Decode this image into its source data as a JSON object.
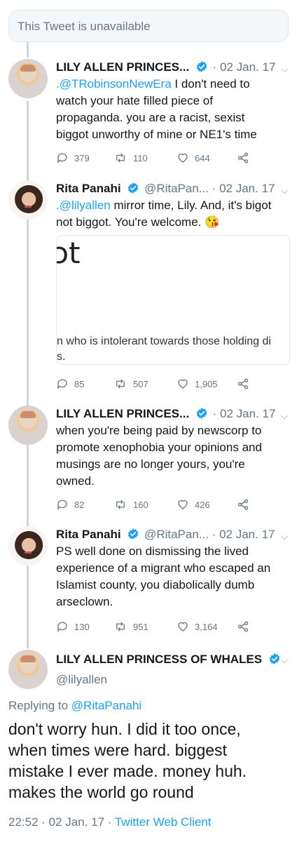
{
  "unavailable": {
    "label": "This Tweet is unavailable"
  },
  "tweets": [
    {
      "name": "LILY ALLEN PRINCES...",
      "handle": "",
      "date": "· 02 Jan. 17",
      "mention": ".@TRobinsonNewEra",
      "line1_rest": " I don't need to",
      "line2": "watch your hate filled piece of",
      "line3": "propaganda. you are a racist, sexist",
      "line4": "biggot unworthy of mine or NE1's time",
      "replies": "379",
      "retweets": "110",
      "likes": "644"
    },
    {
      "name": "Rita Panahi",
      "handle": "@RitaPan...",
      "date": "· 02 Jan. 17",
      "mention": ".@lilyallen",
      "line1_rest": " mirror time, Lily. And, it's bigot",
      "line2": "not biggot. You're welcome. 😘",
      "card_big": "ɔt",
      "card_line1": "n who is intolerant towards those holding di",
      "card_line2": "s.",
      "replies": "85",
      "retweets": "507",
      "likes": "1,905"
    },
    {
      "name": "LILY ALLEN PRINCES...",
      "handle": "",
      "date": "· 02 Jan. 17",
      "line1": "when you're being paid by newscorp to",
      "line2": "promote xenophobia your opinions and",
      "line3": "musings are no longer yours, you're",
      "line4": "owned.",
      "replies": "82",
      "retweets": "160",
      "likes": "426"
    },
    {
      "name": "Rita Panahi",
      "handle": "@RitaPan...",
      "date": "· 02 Jan. 17",
      "line1": "PS well done on dismissing the lived",
      "line2": "experience of a migrant who escaped an",
      "line3": "Islamist county, you diabolically dumb",
      "line4": "arseclown.",
      "replies": "130",
      "retweets": "951",
      "likes": "3,164"
    }
  ],
  "main": {
    "name": "LILY ALLEN PRINCESS OF WHALES",
    "handle": "@lilyallen",
    "replying_prefix": "Replying to ",
    "replying_to": "@RitaPanahi",
    "text_lines": [
      "don't worry hun. I did it too once,",
      "when times were hard. biggest",
      "mistake I ever made. money huh.",
      "makes the world go round"
    ],
    "time": "22:52 · 02 Jan. 17 · ",
    "client": "Twitter Web Client"
  },
  "colors": {
    "accent": "#1da1f2",
    "muted": "#657786",
    "line": "#ccd6dd"
  }
}
